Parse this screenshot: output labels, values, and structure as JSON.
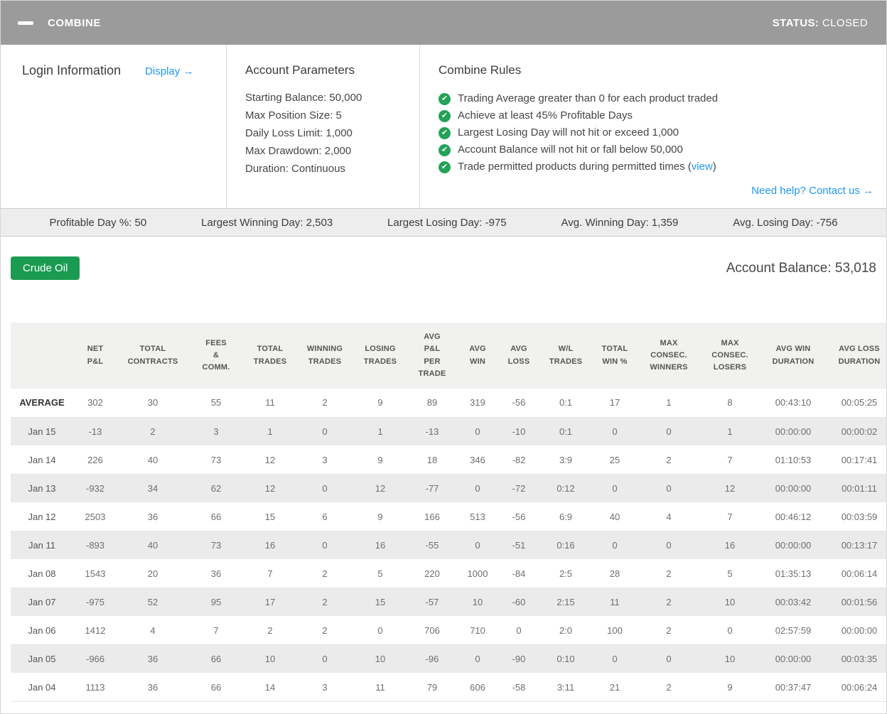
{
  "header": {
    "title": "COMBINE",
    "status_label": "STATUS:",
    "status_value": "CLOSED"
  },
  "login": {
    "title": "Login Information",
    "display_link": "Display →"
  },
  "account_parameters": {
    "title": "Account Parameters",
    "items": [
      "Starting Balance: 50,000",
      "Max Position Size: 5",
      "Daily Loss Limit: 1,000",
      "Max Drawdown: 2,000",
      "Duration: Continuous"
    ]
  },
  "combine_rules": {
    "title": "Combine Rules",
    "rules": [
      {
        "text": "Trading Average greater than 0 for each product traded"
      },
      {
        "text": "Achieve at least 45% Profitable Days"
      },
      {
        "text": "Largest Losing Day will not hit or exceed 1,000"
      },
      {
        "text": "Account Balance will not hit or fall below 50,000"
      },
      {
        "text": "Trade permitted products during permitted times (",
        "link": "view",
        "suffix": ")"
      }
    ],
    "help_link": "Need help? Contact us →"
  },
  "stats_bar": {
    "items": [
      "Profitable Day %: 50",
      "Largest Winning Day: 2,503",
      "Largest Losing Day: -975",
      "Avg. Winning Day: 1,359",
      "Avg. Losing Day: -756"
    ]
  },
  "account": {
    "product_button": "Crude Oil",
    "balance_text": "Account Balance: 53,018"
  },
  "colors": {
    "header_gray": "#9b9b9b",
    "link_blue": "#2196f3",
    "check_green": "#24a257",
    "button_green": "#1a9b51"
  },
  "table": {
    "columns": [
      "NET\nP&L",
      "TOTAL\nCONTRACTS",
      "FEES\n&\nCOMM.",
      "TOTAL\nTRADES",
      "WINNING\nTRADES",
      "LOSING\nTRADES",
      "AVG\nP&L\nPER\nTRADE",
      "AVG\nWIN",
      "AVG\nLOSS",
      "W/L\nTRADES",
      "TOTAL\nWIN %",
      "MAX\nCONSEC.\nWINNERS",
      "MAX\nCONSEC.\nLOSERS",
      "AVG WIN\nDURATION",
      "AVG LOSS\nDURATION"
    ],
    "rows": [
      {
        "label": "AVERAGE",
        "values": [
          "302",
          "30",
          "55",
          "11",
          "2",
          "9",
          "89",
          "319",
          "-56",
          "0:1",
          "17",
          "1",
          "8",
          "00:43:10",
          "00:05:25"
        ]
      },
      {
        "label": "Jan 15",
        "values": [
          "-13",
          "2",
          "3",
          "1",
          "0",
          "1",
          "-13",
          "0",
          "-10",
          "0:1",
          "0",
          "0",
          "1",
          "00:00:00",
          "00:00:02"
        ]
      },
      {
        "label": "Jan 14",
        "values": [
          "226",
          "40",
          "73",
          "12",
          "3",
          "9",
          "18",
          "346",
          "-82",
          "3:9",
          "25",
          "2",
          "7",
          "01:10:53",
          "00:17:41"
        ]
      },
      {
        "label": "Jan 13",
        "values": [
          "-932",
          "34",
          "62",
          "12",
          "0",
          "12",
          "-77",
          "0",
          "-72",
          "0:12",
          "0",
          "0",
          "12",
          "00:00:00",
          "00:01:11"
        ]
      },
      {
        "label": "Jan 12",
        "values": [
          "2503",
          "36",
          "66",
          "15",
          "6",
          "9",
          "166",
          "513",
          "-56",
          "6:9",
          "40",
          "4",
          "7",
          "00:46:12",
          "00:03:59"
        ]
      },
      {
        "label": "Jan 11",
        "values": [
          "-893",
          "40",
          "73",
          "16",
          "0",
          "16",
          "-55",
          "0",
          "-51",
          "0:16",
          "0",
          "0",
          "16",
          "00:00:00",
          "00:13:17"
        ]
      },
      {
        "label": "Jan 08",
        "values": [
          "1543",
          "20",
          "36",
          "7",
          "2",
          "5",
          "220",
          "1000",
          "-84",
          "2:5",
          "28",
          "2",
          "5",
          "01:35:13",
          "00:06:14"
        ]
      },
      {
        "label": "Jan 07",
        "values": [
          "-975",
          "52",
          "95",
          "17",
          "2",
          "15",
          "-57",
          "10",
          "-60",
          "2:15",
          "11",
          "2",
          "10",
          "00:03:42",
          "00:01:56"
        ]
      },
      {
        "label": "Jan 06",
        "values": [
          "1412",
          "4",
          "7",
          "2",
          "2",
          "0",
          "706",
          "710",
          "0",
          "2:0",
          "100",
          "2",
          "0",
          "02:57:59",
          "00:00:00"
        ]
      },
      {
        "label": "Jan 05",
        "values": [
          "-966",
          "36",
          "66",
          "10",
          "0",
          "10",
          "-96",
          "0",
          "-90",
          "0:10",
          "0",
          "0",
          "10",
          "00:00:00",
          "00:03:35"
        ]
      },
      {
        "label": "Jan 04",
        "values": [
          "1113",
          "36",
          "66",
          "14",
          "3",
          "11",
          "79",
          "606",
          "-58",
          "3:11",
          "21",
          "2",
          "9",
          "00:37:47",
          "00:06:24"
        ]
      }
    ]
  }
}
